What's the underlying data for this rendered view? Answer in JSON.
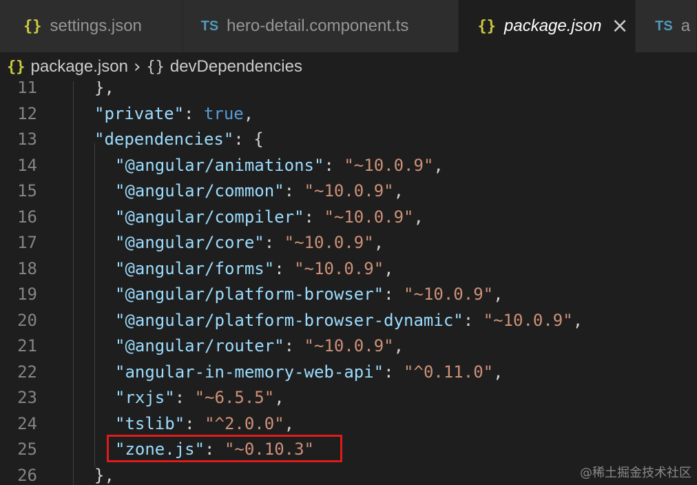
{
  "tabs": [
    {
      "icon": "{}",
      "label": "settings.json",
      "active": false
    },
    {
      "icon": "TS",
      "label": "hero-detail.component.ts",
      "active": false
    },
    {
      "icon": "{}",
      "label": "package.json",
      "active": true,
      "close": "×"
    },
    {
      "icon": "TS",
      "label": "a",
      "active": false
    }
  ],
  "breadcrumb": {
    "file_icon": "{}",
    "file": "package.json",
    "separator": "›",
    "symbol_icon": "{}",
    "symbol": "devDependencies"
  },
  "code_lines": [
    {
      "num": "11",
      "indent": 0,
      "parts": [
        {
          "t": "},",
          "c": "p"
        }
      ]
    },
    {
      "num": "12",
      "indent": 0,
      "parts": [
        {
          "t": "\"private\"",
          "c": "k"
        },
        {
          "t": ": ",
          "c": "p"
        },
        {
          "t": "true",
          "c": "b"
        },
        {
          "t": ",",
          "c": "p"
        }
      ]
    },
    {
      "num": "13",
      "indent": 0,
      "parts": [
        {
          "t": "\"dependencies\"",
          "c": "k"
        },
        {
          "t": ": {",
          "c": "p"
        }
      ]
    },
    {
      "num": "14",
      "indent": 1,
      "parts": [
        {
          "t": "\"@angular/animations\"",
          "c": "k"
        },
        {
          "t": ": ",
          "c": "p"
        },
        {
          "t": "\"~10.0.9\"",
          "c": "s"
        },
        {
          "t": ",",
          "c": "p"
        }
      ]
    },
    {
      "num": "15",
      "indent": 1,
      "parts": [
        {
          "t": "\"@angular/common\"",
          "c": "k"
        },
        {
          "t": ": ",
          "c": "p"
        },
        {
          "t": "\"~10.0.9\"",
          "c": "s"
        },
        {
          "t": ",",
          "c": "p"
        }
      ]
    },
    {
      "num": "16",
      "indent": 1,
      "parts": [
        {
          "t": "\"@angular/compiler\"",
          "c": "k"
        },
        {
          "t": ": ",
          "c": "p"
        },
        {
          "t": "\"~10.0.9\"",
          "c": "s"
        },
        {
          "t": ",",
          "c": "p"
        }
      ]
    },
    {
      "num": "17",
      "indent": 1,
      "parts": [
        {
          "t": "\"@angular/core\"",
          "c": "k"
        },
        {
          "t": ": ",
          "c": "p"
        },
        {
          "t": "\"~10.0.9\"",
          "c": "s"
        },
        {
          "t": ",",
          "c": "p"
        }
      ]
    },
    {
      "num": "18",
      "indent": 1,
      "parts": [
        {
          "t": "\"@angular/forms\"",
          "c": "k"
        },
        {
          "t": ": ",
          "c": "p"
        },
        {
          "t": "\"~10.0.9\"",
          "c": "s"
        },
        {
          "t": ",",
          "c": "p"
        }
      ]
    },
    {
      "num": "19",
      "indent": 1,
      "parts": [
        {
          "t": "\"@angular/platform-browser\"",
          "c": "k"
        },
        {
          "t": ": ",
          "c": "p"
        },
        {
          "t": "\"~10.0.9\"",
          "c": "s"
        },
        {
          "t": ",",
          "c": "p"
        }
      ]
    },
    {
      "num": "20",
      "indent": 1,
      "parts": [
        {
          "t": "\"@angular/platform-browser-dynamic\"",
          "c": "k"
        },
        {
          "t": ": ",
          "c": "p"
        },
        {
          "t": "\"~10.0.9\"",
          "c": "s"
        },
        {
          "t": ",",
          "c": "p"
        }
      ]
    },
    {
      "num": "21",
      "indent": 1,
      "parts": [
        {
          "t": "\"@angular/router\"",
          "c": "k"
        },
        {
          "t": ": ",
          "c": "p"
        },
        {
          "t": "\"~10.0.9\"",
          "c": "s"
        },
        {
          "t": ",",
          "c": "p"
        }
      ]
    },
    {
      "num": "22",
      "indent": 1,
      "parts": [
        {
          "t": "\"angular-in-memory-web-api\"",
          "c": "k"
        },
        {
          "t": ": ",
          "c": "p"
        },
        {
          "t": "\"^0.11.0\"",
          "c": "s"
        },
        {
          "t": ",",
          "c": "p"
        }
      ]
    },
    {
      "num": "23",
      "indent": 1,
      "parts": [
        {
          "t": "\"rxjs\"",
          "c": "k"
        },
        {
          "t": ": ",
          "c": "p"
        },
        {
          "t": "\"~6.5.5\"",
          "c": "s"
        },
        {
          "t": ",",
          "c": "p"
        }
      ]
    },
    {
      "num": "24",
      "indent": 1,
      "parts": [
        {
          "t": "\"tslib\"",
          "c": "k"
        },
        {
          "t": ": ",
          "c": "p"
        },
        {
          "t": "\"^2.0.0\"",
          "c": "s"
        },
        {
          "t": ",",
          "c": "p"
        }
      ]
    },
    {
      "num": "25",
      "indent": 1,
      "parts": [
        {
          "t": "\"zone.js\"",
          "c": "k"
        },
        {
          "t": ": ",
          "c": "p"
        },
        {
          "t": "\"~0.10.3\"",
          "c": "s"
        }
      ]
    },
    {
      "num": "26",
      "indent": 0,
      "parts": [
        {
          "t": "},",
          "c": "p"
        }
      ]
    }
  ],
  "highlighted_line": "25",
  "watermark": "@稀土掘金技术社区",
  "colors": {
    "key": "#9cdcfe",
    "string": "#ce9178",
    "boolean": "#569cd6",
    "punctuation": "#d4d4d4",
    "highlight_border": "#e01b1b"
  }
}
